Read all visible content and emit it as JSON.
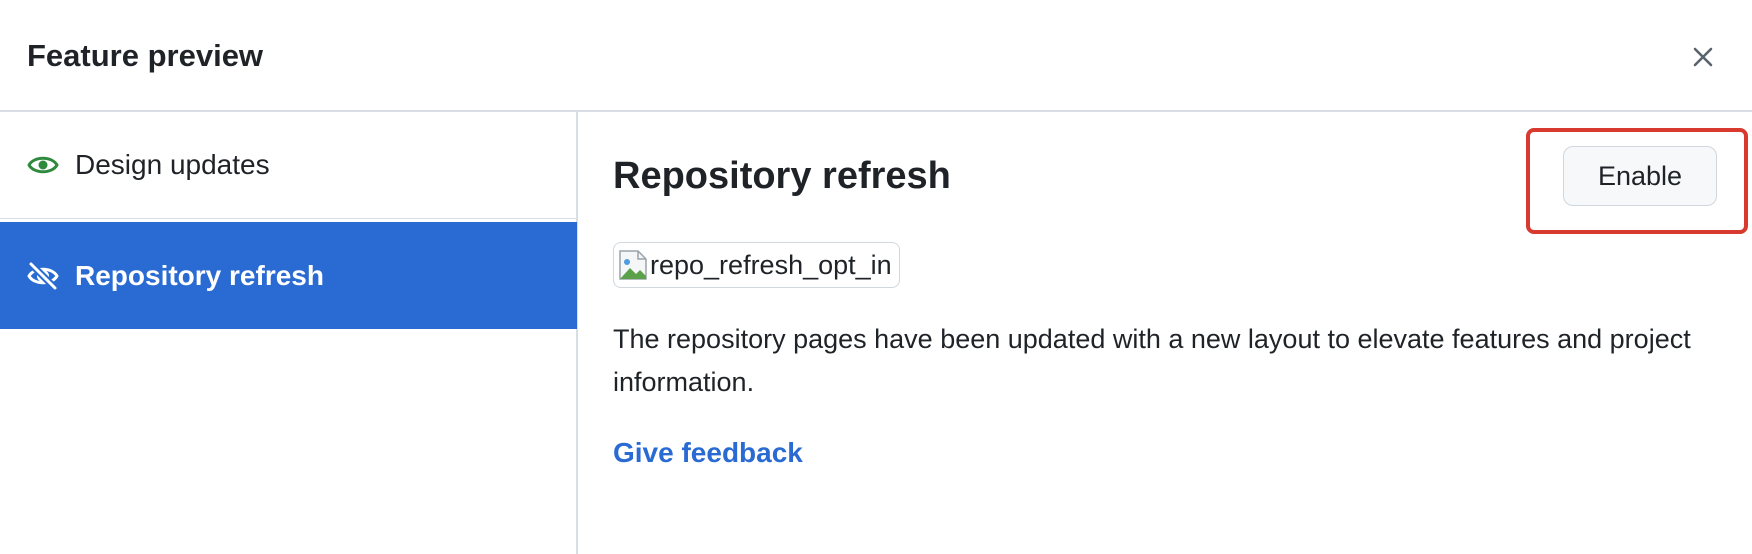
{
  "dialog": {
    "title": "Feature preview",
    "close_icon": "close-icon"
  },
  "sidebar": {
    "items": [
      {
        "label": "Design updates",
        "icon": "eye-icon",
        "selected": false
      },
      {
        "label": "Repository refresh",
        "icon": "eye-closed-icon",
        "selected": true
      }
    ]
  },
  "main": {
    "title": "Repository refresh",
    "enable_label": "Enable",
    "image_alt": "repo_refresh_opt_in",
    "description": "The repository pages have been updated with a new layout to elevate features and project information.",
    "feedback_label": "Give feedback"
  },
  "colors": {
    "selected_bg": "#2a6bd3",
    "link": "#2a6bd3",
    "annotation": "#d93a2f",
    "eye_icon": "#2f8a3e"
  }
}
